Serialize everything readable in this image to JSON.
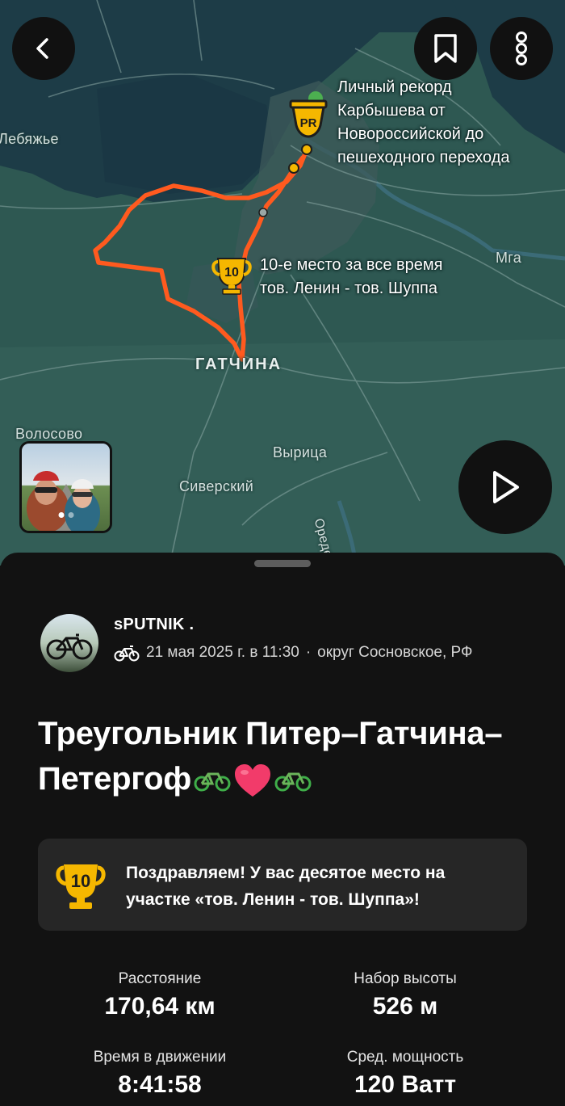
{
  "map": {
    "labels": {
      "lebyazhye": "Лебяжье",
      "mga": "Мга",
      "gatchina": "ГАТЧИНА",
      "volosovo": "Волосово",
      "vyritsa": "Вырица",
      "siversky": "Сиверский",
      "oredezh": "Оредеж"
    },
    "callouts": {
      "pr_line1": "Личный рекорд",
      "pr_line2": "Карбышева от",
      "pr_line3": "Новороссийской до",
      "pr_line4": "пешеходного перехода",
      "top10_line1": "10-е место за все время",
      "top10_line2": "тов. Ленин - тов. Шуппа"
    },
    "pr_badge": "PR",
    "rank_badge": "10",
    "route_color": "#ff5a1f",
    "photo_count": 2,
    "photo_active_index": 1
  },
  "buttons": {
    "back": "back-icon",
    "bookmark": "bookmark-icon",
    "more": "more-icon",
    "play": "play-icon"
  },
  "activity": {
    "athlete": "sPUTNIK .",
    "date": "21 мая 2025 г. в 11:30",
    "separator": "·",
    "location": "округ Сосновское, РФ",
    "sport_icon": "bike-icon",
    "title": "Треугольник Питер–Гатчина–Петергоф"
  },
  "banner": {
    "rank": "10",
    "line1": "Поздравляем! У вас десятое место на",
    "line2": "участке «тов. Ленин - тов. Шуппа»!"
  },
  "stats": {
    "distance_label": "Расстояние",
    "distance_value": "170,64 км",
    "elevation_label": "Набор высоты",
    "elevation_value": "526 м",
    "moving_time_label": "Время в движении",
    "moving_time_value": "8:41:58",
    "avg_power_label": "Сред. мощность",
    "avg_power_value": "120 Ватт"
  }
}
